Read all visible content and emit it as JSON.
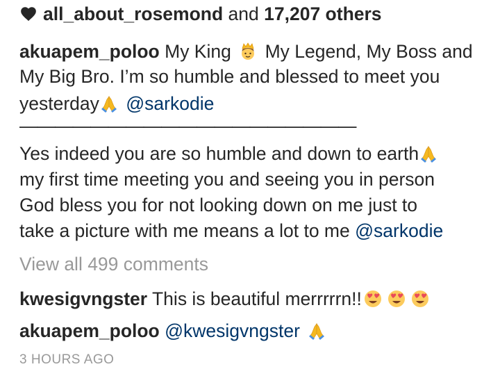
{
  "likes": {
    "user": "all_about_rosemond",
    "connector": "and",
    "count": "17,207 others"
  },
  "caption": {
    "username": "akuapem_poloo",
    "line1_a": "My King",
    "line1_b": "My Legend, My Boss and",
    "line2": "My Big Bro. I’m so humble and blessed to meet you",
    "line3_a": "yesterday",
    "mention": "@sarkodie",
    "divider": "———————————————————",
    "line4": "Yes indeed you are so humble and down to earth",
    "line5": "my first time meeting you and seeing you in person",
    "line6": "God bless you for not looking down on me just to",
    "line7_a": "take a picture with me means a lot to me",
    "line7_mention": "@sarkodie"
  },
  "view_all_comments": "View all 499 comments",
  "comments": [
    {
      "username": "kwesigvngster",
      "text": "This is beautiful merrrrrn!!"
    },
    {
      "username": "akuapem_poloo",
      "mention": "@kwesigvngster"
    }
  ],
  "timestamp": "3 HOURS AGO",
  "icons": [
    "heart-icon",
    "crown-prince-emoji",
    "praying-hands-emoji",
    "heart-eyes-emoji"
  ],
  "colors": {
    "text": "#262626",
    "link": "#003569",
    "muted": "#999999",
    "background": "#ffffff"
  }
}
